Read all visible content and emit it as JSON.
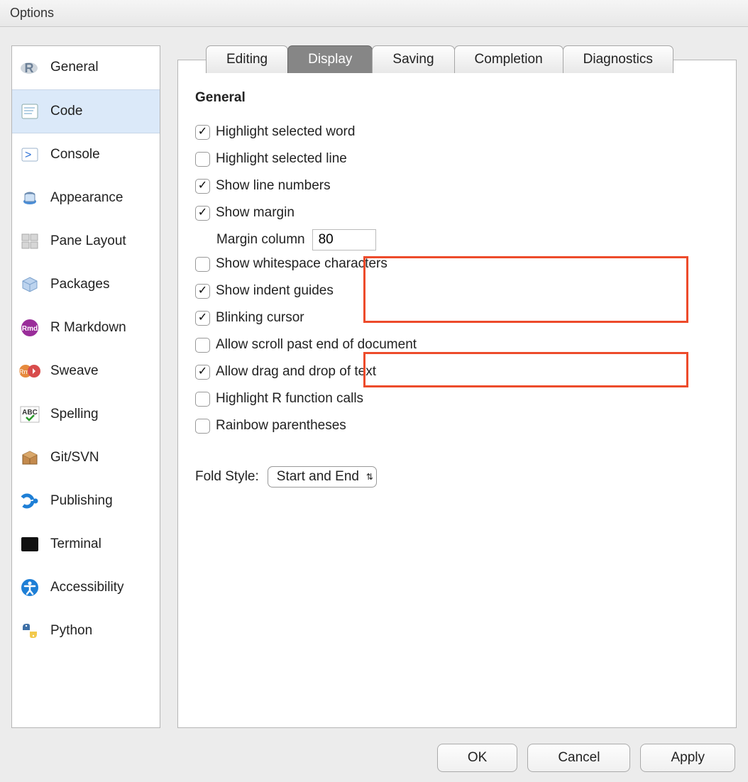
{
  "window": {
    "title": "Options"
  },
  "sidebar": {
    "items": [
      {
        "label": "General"
      },
      {
        "label": "Code"
      },
      {
        "label": "Console"
      },
      {
        "label": "Appearance"
      },
      {
        "label": "Pane Layout"
      },
      {
        "label": "Packages"
      },
      {
        "label": "R Markdown"
      },
      {
        "label": "Sweave"
      },
      {
        "label": "Spelling"
      },
      {
        "label": "Git/SVN"
      },
      {
        "label": "Publishing"
      },
      {
        "label": "Terminal"
      },
      {
        "label": "Accessibility"
      },
      {
        "label": "Python"
      }
    ],
    "activeIndex": 1
  },
  "tabs": {
    "items": [
      {
        "label": "Editing"
      },
      {
        "label": "Display"
      },
      {
        "label": "Saving"
      },
      {
        "label": "Completion"
      },
      {
        "label": "Diagnostics"
      }
    ],
    "activeIndex": 1
  },
  "section": {
    "heading": "General"
  },
  "options": {
    "highlight_word": {
      "label": "Highlight selected word",
      "checked": true
    },
    "highlight_line": {
      "label": "Highlight selected line",
      "checked": false
    },
    "line_numbers": {
      "label": "Show line numbers",
      "checked": true
    },
    "show_margin": {
      "label": "Show margin",
      "checked": true,
      "sublabel": "Margin column",
      "margin_value": "80"
    },
    "whitespace": {
      "label": "Show whitespace characters",
      "checked": false
    },
    "indent_guides": {
      "label": "Show indent guides",
      "checked": true
    },
    "blinking_cursor": {
      "label": "Blinking cursor",
      "checked": true
    },
    "scroll_past_end": {
      "label": "Allow scroll past end of document",
      "checked": false
    },
    "drag_drop": {
      "label": "Allow drag and drop of text",
      "checked": true
    },
    "highlight_rfunc": {
      "label": "Highlight R function calls",
      "checked": false
    },
    "rainbow_paren": {
      "label": "Rainbow parentheses",
      "checked": false
    }
  },
  "fold": {
    "label": "Fold Style:",
    "value": "Start and End"
  },
  "buttons": {
    "ok": "OK",
    "cancel": "Cancel",
    "apply": "Apply"
  }
}
